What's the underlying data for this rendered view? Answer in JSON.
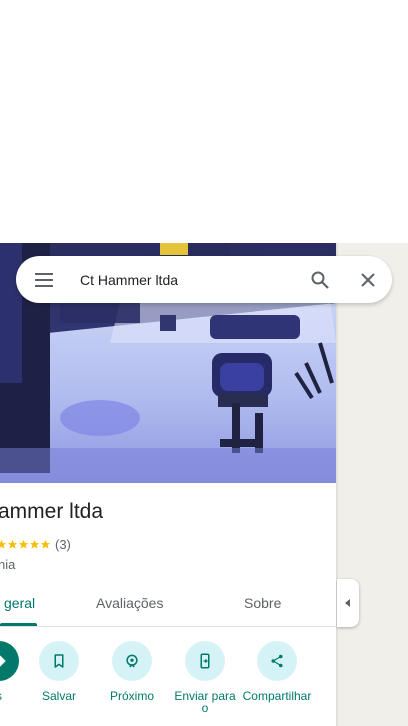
{
  "search": {
    "query": "Ct Hammer ltda"
  },
  "place": {
    "title": "ammer ltda",
    "rating": "(3)",
    "category": "nia"
  },
  "tabs": [
    {
      "label": "geral"
    },
    {
      "label": "Avaliações"
    },
    {
      "label": "Sobre"
    }
  ],
  "actions": [
    {
      "label": "s",
      "icon": "directions-icon"
    },
    {
      "label": "Salvar",
      "icon": "bookmark-icon"
    },
    {
      "label": "Próximo",
      "icon": "nearby-icon"
    },
    {
      "label": "Enviar para o",
      "icon": "send-to-phone-icon"
    },
    {
      "label": "Compartilhar",
      "icon": "share-icon"
    }
  ],
  "colors": {
    "accent": "#00796b",
    "action_bg": "#d5f3f6",
    "star": "#fbbc04"
  }
}
